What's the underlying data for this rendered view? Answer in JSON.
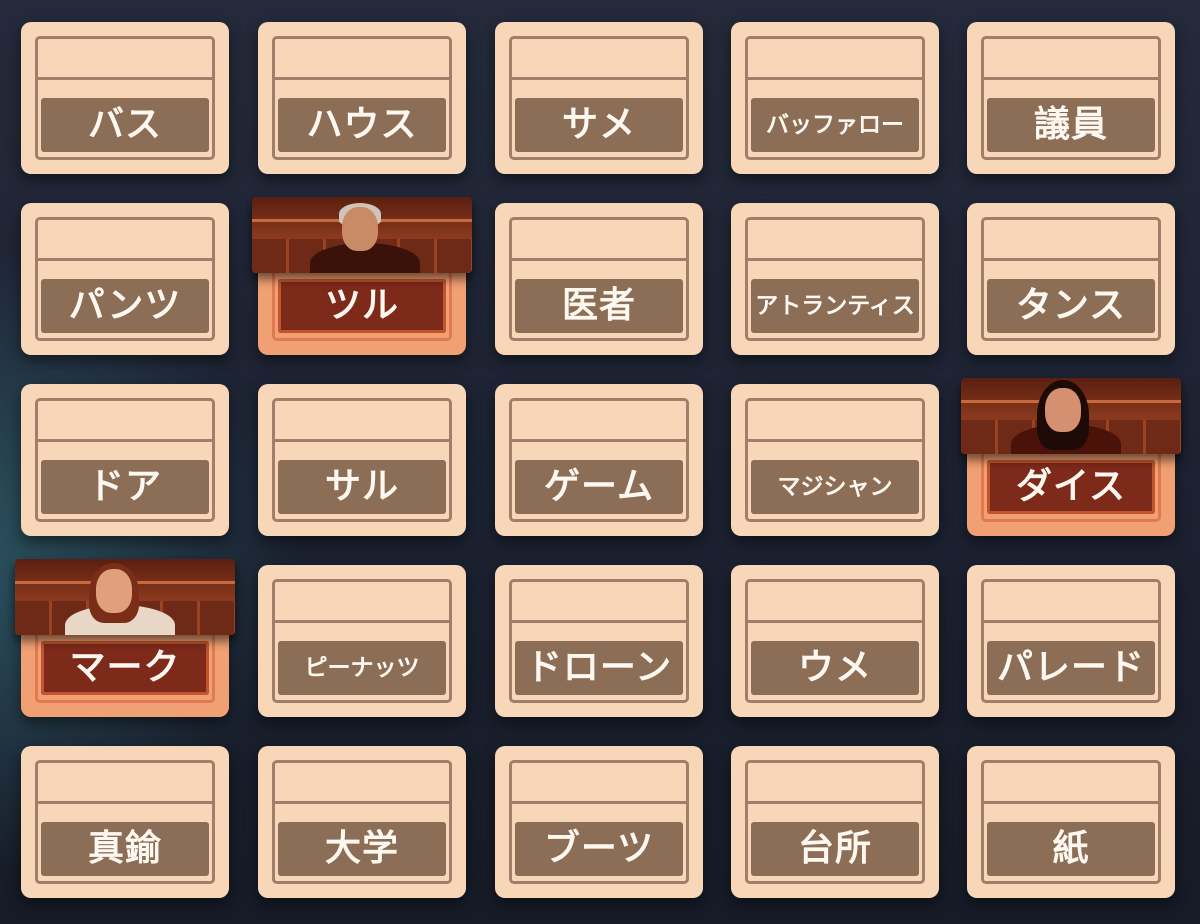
{
  "board": {
    "rows": [
      {
        "cards": [
          {
            "word": "バス",
            "revealed": false
          },
          {
            "word": "ハウス",
            "revealed": false
          },
          {
            "word": "サメ",
            "revealed": false
          },
          {
            "word": "バッファロー",
            "revealed": false
          },
          {
            "word": "議員",
            "revealed": false
          }
        ]
      },
      {
        "cards": [
          {
            "word": "パンツ",
            "revealed": false
          },
          {
            "word": "ツル",
            "revealed": true,
            "agent": "agent-old-man-portrait"
          },
          {
            "word": "医者",
            "revealed": false
          },
          {
            "word": "アトランティス",
            "revealed": false
          },
          {
            "word": "タンス",
            "revealed": false
          }
        ]
      },
      {
        "cards": [
          {
            "word": "ドア",
            "revealed": false
          },
          {
            "word": "サル",
            "revealed": false
          },
          {
            "word": "ゲーム",
            "revealed": false
          },
          {
            "word": "マジシャン",
            "revealed": false
          },
          {
            "word": "ダイス",
            "revealed": true,
            "agent": "agent-woman-dark-hair-portrait"
          }
        ]
      },
      {
        "cards": [
          {
            "word": "マーク",
            "revealed": true,
            "agent": "agent-woman-glasses-portrait"
          },
          {
            "word": "ピーナッツ",
            "revealed": false
          },
          {
            "word": "ドローン",
            "revealed": false
          },
          {
            "word": "ウメ",
            "revealed": false
          },
          {
            "word": "パレード",
            "revealed": false
          }
        ]
      },
      {
        "cards": [
          {
            "word": "真鍮",
            "revealed": false
          },
          {
            "word": "大学",
            "revealed": false
          },
          {
            "word": "ブーツ",
            "revealed": false
          },
          {
            "word": "台所",
            "revealed": false
          },
          {
            "word": "紙",
            "revealed": false
          }
        ]
      }
    ]
  },
  "colors": {
    "card_face": "#f8d6b8",
    "card_frame": "#a07e6a",
    "word_plate": "#8c6e56",
    "red_team_card": "#f0a072",
    "red_team_plate": "#7e2a1a"
  }
}
